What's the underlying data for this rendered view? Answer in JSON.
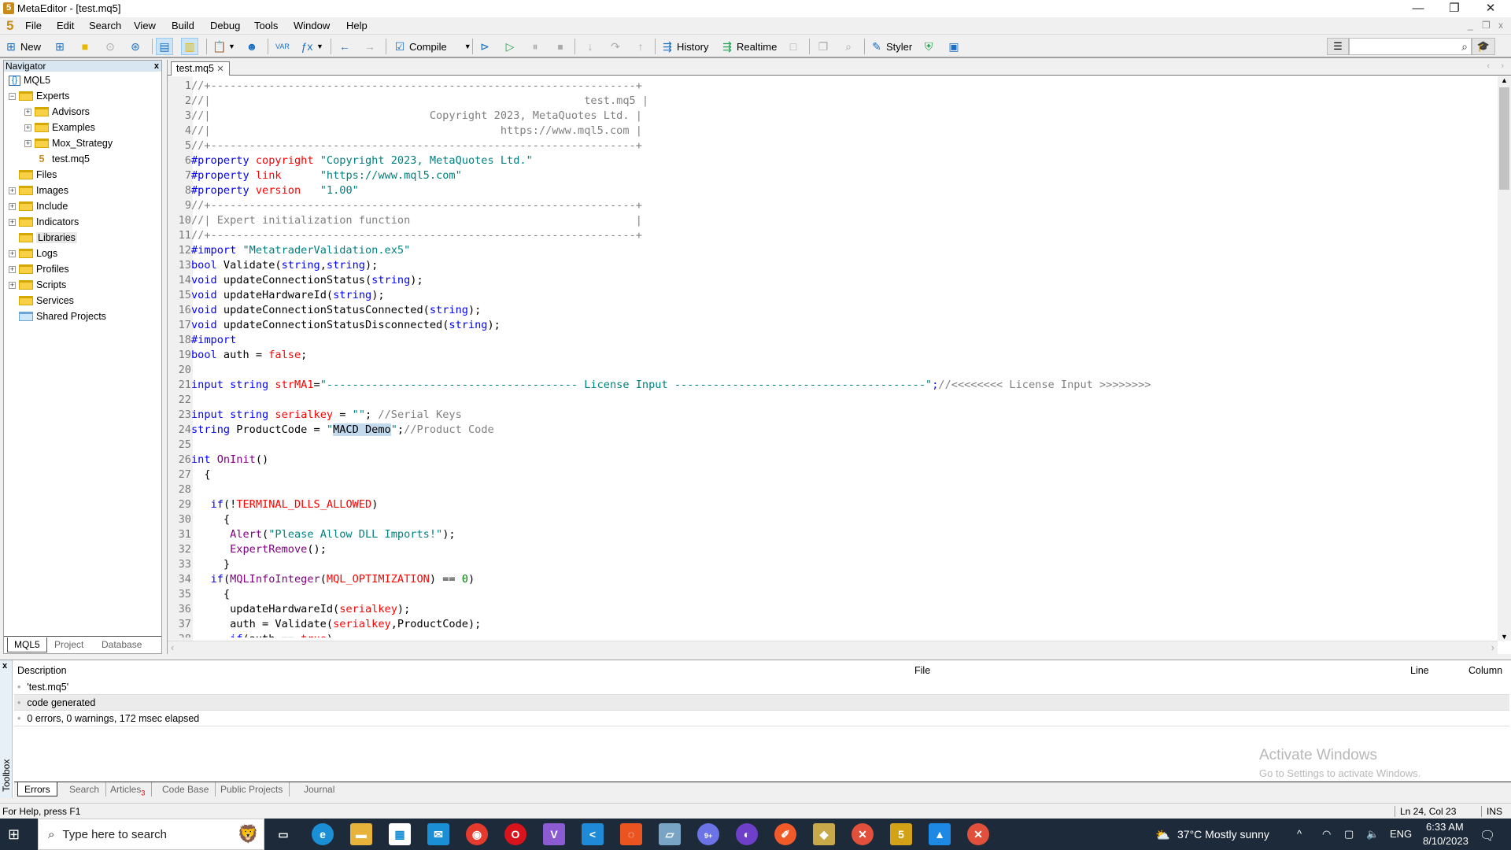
{
  "window": {
    "title": "MetaEditor - [test.mq5]",
    "minimize": "—",
    "maximize": "❐",
    "close": "✕",
    "mdi_min": "_",
    "mdi_restore": "❐",
    "mdi_close": "x"
  },
  "menu": [
    "File",
    "Edit",
    "Search",
    "View",
    "Build",
    "Debug",
    "Tools",
    "Window",
    "Help"
  ],
  "toolbar": {
    "new_label": "New",
    "compile_label": "Compile",
    "history_label": "History",
    "realtime_label": "Realtime",
    "styler_label": "Styler",
    "search_placeholder": ""
  },
  "navigator": {
    "title": "Navigator",
    "close": "x",
    "root": "MQL5",
    "items": [
      {
        "label": "Experts",
        "depth": 1,
        "expander": "−"
      },
      {
        "label": "Advisors",
        "depth": 2,
        "expander": "+"
      },
      {
        "label": "Examples",
        "depth": 2,
        "expander": "+"
      },
      {
        "label": "Mox_Strategy",
        "depth": 2,
        "expander": "+"
      },
      {
        "label": "test.mq5",
        "depth": 2,
        "expander": "",
        "file": true
      },
      {
        "label": "Files",
        "depth": 1,
        "expander": ""
      },
      {
        "label": "Images",
        "depth": 1,
        "expander": "+"
      },
      {
        "label": "Include",
        "depth": 1,
        "expander": "+"
      },
      {
        "label": "Indicators",
        "depth": 1,
        "expander": "+"
      },
      {
        "label": "Libraries",
        "depth": 1,
        "expander": "",
        "highlight": true
      },
      {
        "label": "Logs",
        "depth": 1,
        "expander": "+"
      },
      {
        "label": "Profiles",
        "depth": 1,
        "expander": "+"
      },
      {
        "label": "Scripts",
        "depth": 1,
        "expander": "+"
      },
      {
        "label": "Services",
        "depth": 1,
        "expander": ""
      },
      {
        "label": "Shared Projects",
        "depth": 1,
        "expander": "",
        "shared": true
      }
    ],
    "tabs": [
      "MQL5",
      "Project",
      "Database"
    ]
  },
  "editor": {
    "tab": "test.mq5",
    "tab_close": "✕",
    "lines": [
      [
        [
          "cm",
          "//+------------------------------------------------------------------+"
        ]
      ],
      [
        [
          "cm",
          "//|                                                          test.mq5 |"
        ]
      ],
      [
        [
          "cm",
          "//|                                  Copyright 2023, MetaQuotes Ltd. |"
        ]
      ],
      [
        [
          "cm",
          "//|                                             https://www.mql5.com |"
        ]
      ],
      [
        [
          "cm",
          "//+------------------------------------------------------------------+"
        ]
      ],
      [
        [
          "pp",
          "#property "
        ],
        [
          "rd",
          "copyright"
        ],
        [
          "tx",
          " "
        ],
        [
          "st",
          "\"Copyright 2023, MetaQuotes Ltd.\""
        ]
      ],
      [
        [
          "pp",
          "#property "
        ],
        [
          "rd",
          "link"
        ],
        [
          "tx",
          "      "
        ],
        [
          "st",
          "\"https://www.mql5.com\""
        ]
      ],
      [
        [
          "pp",
          "#property "
        ],
        [
          "rd",
          "version"
        ],
        [
          "tx",
          "   "
        ],
        [
          "st",
          "\"1.00\""
        ]
      ],
      [
        [
          "cm",
          "//+------------------------------------------------------------------+"
        ]
      ],
      [
        [
          "cm",
          "//| Expert initialization function                                   |"
        ]
      ],
      [
        [
          "cm",
          "//+------------------------------------------------------------------+"
        ]
      ],
      [
        [
          "pp",
          "#import "
        ],
        [
          "st",
          "\"MetatraderValidation.ex5\""
        ]
      ],
      [
        [
          "kw",
          "bool"
        ],
        [
          "tx",
          " Validate("
        ],
        [
          "kw",
          "string"
        ],
        [
          "tx",
          ","
        ],
        [
          "kw",
          "string"
        ],
        [
          "tx",
          ");"
        ]
      ],
      [
        [
          "kw",
          "void"
        ],
        [
          "tx",
          " updateConnectionStatus("
        ],
        [
          "kw",
          "string"
        ],
        [
          "tx",
          ");"
        ]
      ],
      [
        [
          "kw",
          "void"
        ],
        [
          "tx",
          " updateHardwareId("
        ],
        [
          "kw",
          "string"
        ],
        [
          "tx",
          ");"
        ]
      ],
      [
        [
          "kw",
          "void"
        ],
        [
          "tx",
          " updateConnectionStatusConnected("
        ],
        [
          "kw",
          "string"
        ],
        [
          "tx",
          ");"
        ]
      ],
      [
        [
          "kw",
          "void"
        ],
        [
          "tx",
          " updateConnectionStatusDisconnected("
        ],
        [
          "kw",
          "string"
        ],
        [
          "tx",
          ");"
        ]
      ],
      [
        [
          "pp",
          "#import"
        ]
      ],
      [
        [
          "kw",
          "bool"
        ],
        [
          "tx",
          " auth = "
        ],
        [
          "rd",
          "false"
        ],
        [
          "tx",
          ";"
        ]
      ],
      [],
      [
        [
          "kw",
          "input string "
        ],
        [
          "rd",
          "strMA1"
        ],
        [
          "tx",
          "="
        ],
        [
          "st",
          "\"--------------------------------------- License Input ---------------------------------------\""
        ],
        [
          "kw",
          ";"
        ],
        [
          "cm",
          "//<<<<<<<< License Input >>>>>>>>"
        ]
      ],
      [],
      [
        [
          "kw",
          "input string "
        ],
        [
          "rd",
          "serialkey"
        ],
        [
          "tx",
          " = "
        ],
        [
          "st",
          "\"\""
        ],
        [
          "tx",
          "; "
        ],
        [
          "cm",
          "//Serial Keys"
        ]
      ],
      [
        [
          "kw",
          "string"
        ],
        [
          "tx",
          " ProductCode = "
        ],
        [
          "st",
          "\""
        ],
        [
          "sel",
          "MACD Demo"
        ],
        [
          "st",
          "\""
        ],
        [
          "tx",
          ";"
        ],
        [
          "cm",
          "//Product Code"
        ]
      ],
      [],
      [
        [
          "kw",
          "int"
        ],
        [
          "tx",
          " "
        ],
        [
          "fn",
          "OnInit"
        ],
        [
          "tx",
          "()"
        ]
      ],
      [
        [
          "tx",
          "  {"
        ]
      ],
      [],
      [
        [
          "tx",
          "   "
        ],
        [
          "kw",
          "if"
        ],
        [
          "tx",
          "(!"
        ],
        [
          "rd",
          "TERMINAL_DLLS_ALLOWED"
        ],
        [
          "tx",
          ")"
        ]
      ],
      [
        [
          "tx",
          "     {"
        ]
      ],
      [
        [
          "tx",
          "      "
        ],
        [
          "fn",
          "Alert"
        ],
        [
          "tx",
          "("
        ],
        [
          "st",
          "\"Please Allow DLL Imports!\""
        ],
        [
          "tx",
          ");"
        ]
      ],
      [
        [
          "tx",
          "      "
        ],
        [
          "fn",
          "ExpertRemove"
        ],
        [
          "tx",
          "();"
        ]
      ],
      [
        [
          "tx",
          "     }"
        ]
      ],
      [
        [
          "tx",
          "   "
        ],
        [
          "kw",
          "if"
        ],
        [
          "tx",
          "("
        ],
        [
          "fn",
          "MQLInfoInteger"
        ],
        [
          "tx",
          "("
        ],
        [
          "rd",
          "MQL_OPTIMIZATION"
        ],
        [
          "tx",
          ") == "
        ],
        [
          "nm",
          "0"
        ],
        [
          "tx",
          ")"
        ]
      ],
      [
        [
          "tx",
          "     {"
        ]
      ],
      [
        [
          "tx",
          "      updateHardwareId("
        ],
        [
          "rd",
          "serialkey"
        ],
        [
          "tx",
          ");"
        ]
      ],
      [
        [
          "tx",
          "      auth = Validate("
        ],
        [
          "rd",
          "serialkey"
        ],
        [
          "tx",
          ",ProductCode);"
        ]
      ],
      [
        [
          "tx",
          "      "
        ],
        [
          "kw",
          "if"
        ],
        [
          "tx",
          "(auth == "
        ],
        [
          "rd",
          "true"
        ],
        [
          "tx",
          ")"
        ]
      ]
    ]
  },
  "toolbox": {
    "label": "Toolbox",
    "close": "x",
    "columns": [
      "Description",
      "File",
      "Line",
      "Column"
    ],
    "rows": [
      "'test.mq5'",
      "code generated",
      "0 errors, 0 warnings, 172 msec elapsed"
    ],
    "tabs": [
      "Errors",
      "Search",
      "Articles",
      "Code Base",
      "Public Projects",
      "Journal"
    ],
    "articles_badge": "3"
  },
  "watermark": {
    "line1": "Activate Windows",
    "line2": "Go to Settings to activate Windows."
  },
  "status": {
    "help": "For Help, press F1",
    "position": "Ln 24, Col 23",
    "mode": "INS"
  },
  "taskbar": {
    "search_placeholder": "Type here to search",
    "weather": "37°C  Mostly sunny",
    "lang": "ENG",
    "time": "6:33 AM",
    "date": "8/10/2023",
    "discord_badge": "9+"
  }
}
